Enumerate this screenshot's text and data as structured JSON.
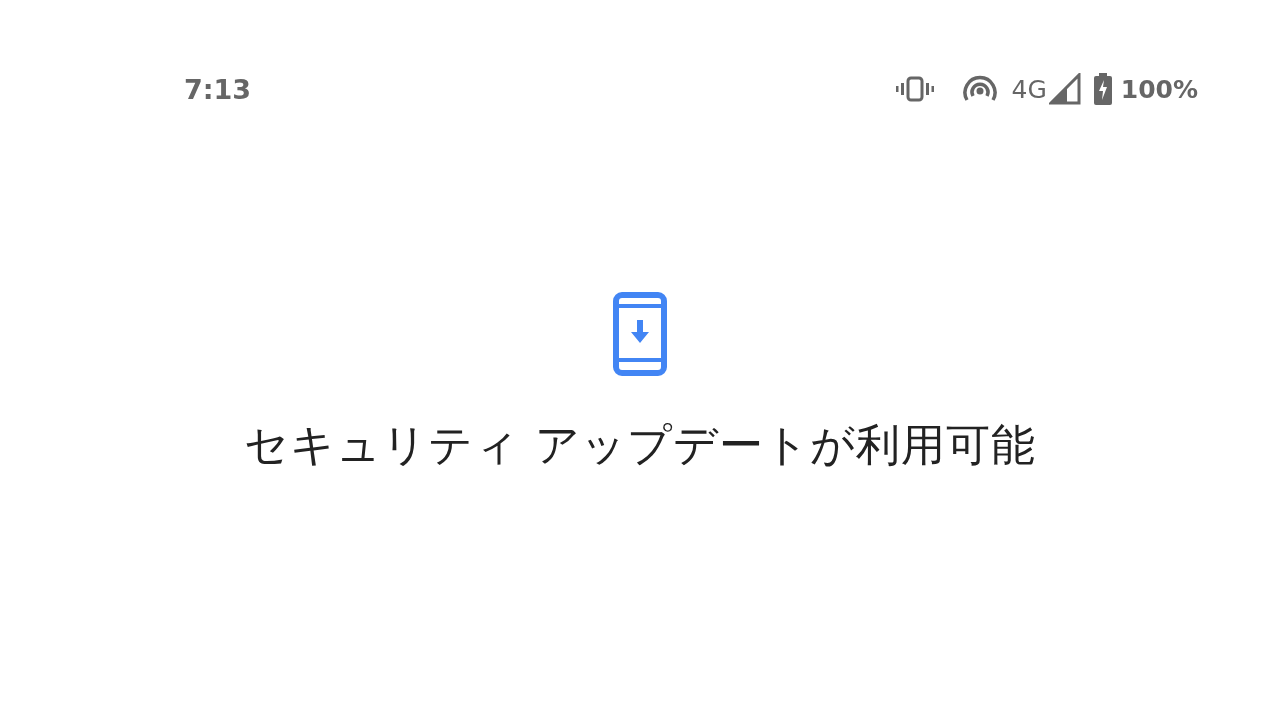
{
  "status_bar": {
    "time": "7:13",
    "network": "4G",
    "battery": "100%"
  },
  "message": {
    "title": "セキュリティ アップデートが利用可能"
  }
}
